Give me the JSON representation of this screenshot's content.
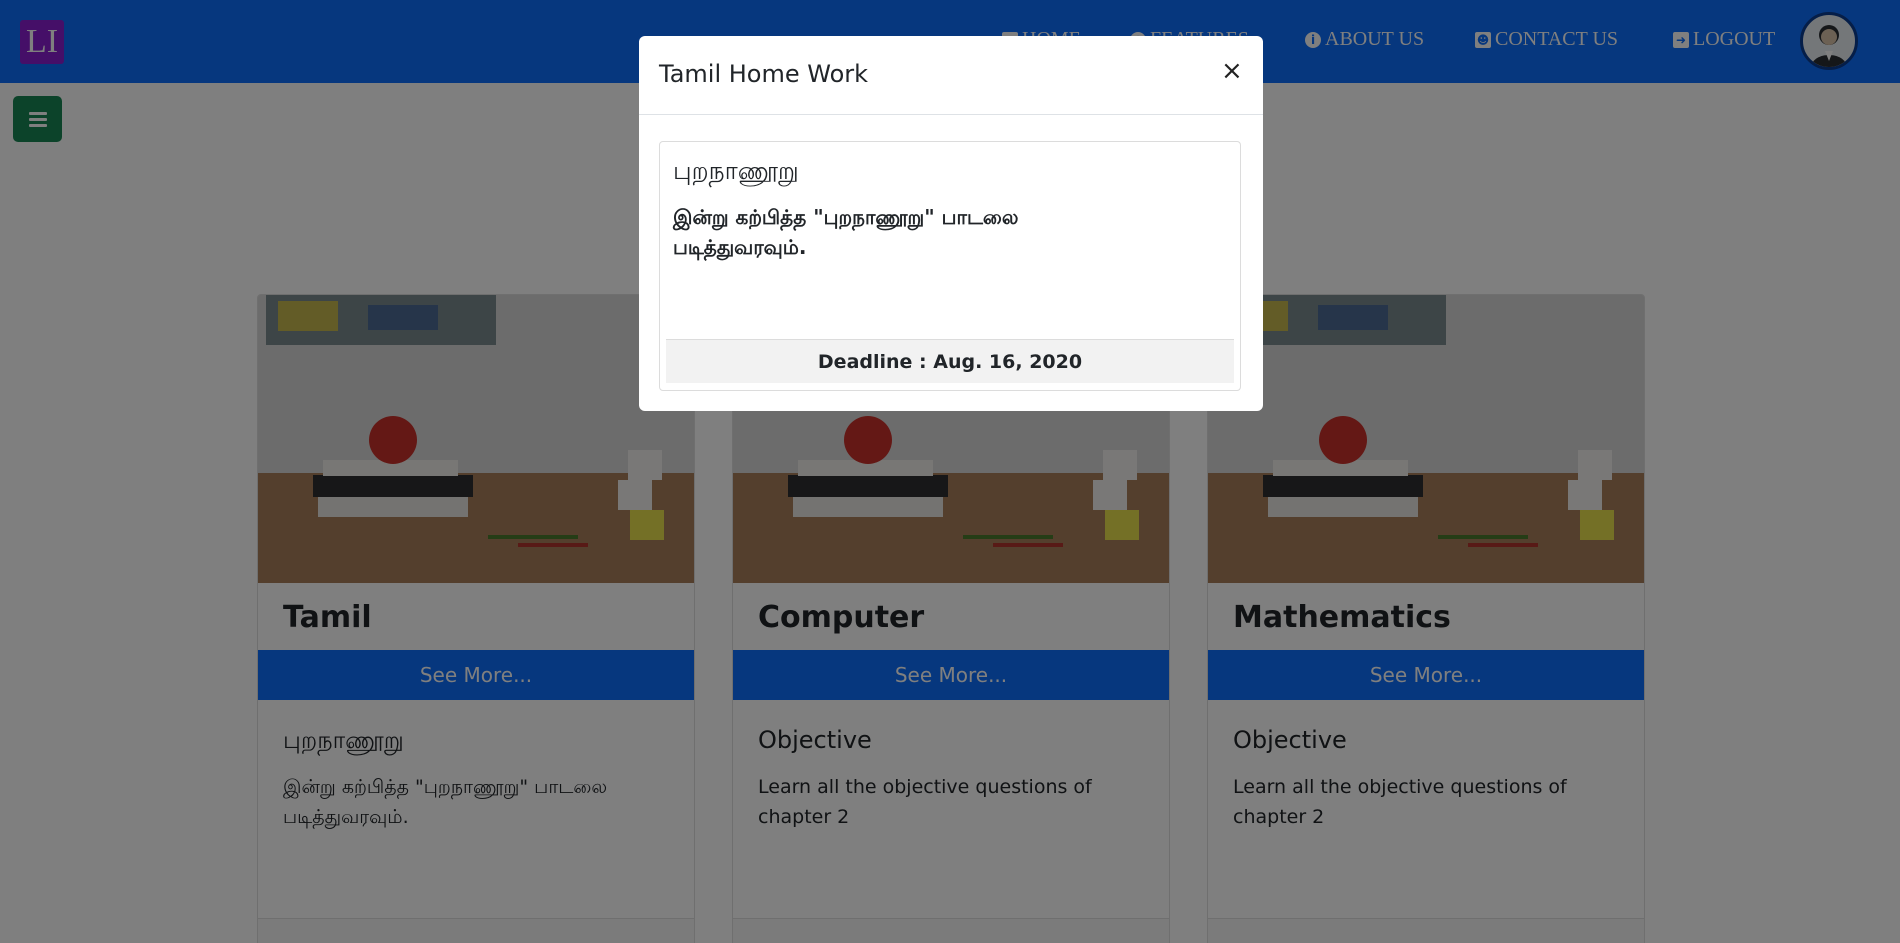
{
  "navbar": {
    "logo_text": "LI",
    "color": "#0d6efd",
    "links": [
      {
        "label": "HOME",
        "icon": "home-icon"
      },
      {
        "label": "FEATURES",
        "icon": "star-icon"
      },
      {
        "label": "ABOUT US",
        "icon": "info-icon"
      },
      {
        "label": "CONTACT US",
        "icon": "contact-icon"
      },
      {
        "label": "LOGOUT",
        "icon": "logout-icon"
      }
    ],
    "avatar_icon": "user-avatar-icon"
  },
  "sidebar_toggle": {
    "icon": "menu-icon",
    "color": "#198754"
  },
  "cards": [
    {
      "title": "Tamil",
      "button": "See More...",
      "subtitle": "புறநாணூறு",
      "text": "இன்று கற்பித்த \"புறநாணூறு\" பாடலை படித்துவரவும்."
    },
    {
      "title": "Computer",
      "button": "See More...",
      "subtitle": "Objective",
      "text": "Learn all the objective questions of chapter 2"
    },
    {
      "title": "Mathematics",
      "button": "See More...",
      "subtitle": "Objective",
      "text": "Learn all the objective questions of chapter 2"
    }
  ],
  "modal": {
    "title": "Tamil Home Work",
    "close": "×",
    "subtitle": "புறநாணூறு",
    "text": "இன்று கற்பித்த \"புறநாணூறு\" பாடலை படித்துவரவும்.",
    "deadline": "Deadline : Aug. 16, 2020"
  }
}
